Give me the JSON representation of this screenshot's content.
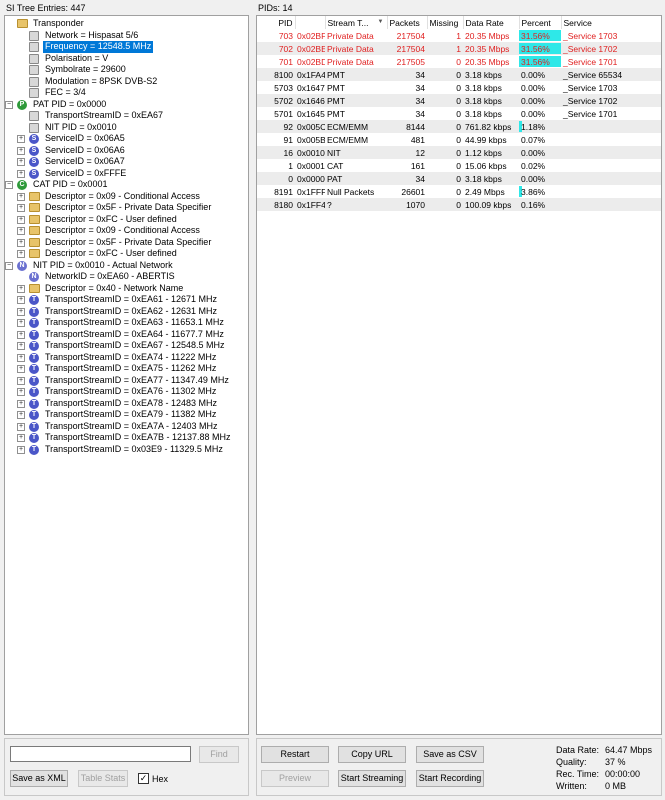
{
  "tree_header": "SI Tree Entries: 447",
  "pids_header": "PIDs: 14",
  "tree": [
    {
      "label": "Transponder",
      "level": 0,
      "icon": "folder",
      "exp": ""
    },
    {
      "label": "Network = Hispasat 5/6",
      "level": 1,
      "icon": "gray",
      "exp": ""
    },
    {
      "label": "Frequency = 12548.5 MHz",
      "level": 1,
      "icon": "gray",
      "exp": "",
      "selected": true
    },
    {
      "label": "Polarisation = V",
      "level": 1,
      "icon": "gray",
      "exp": ""
    },
    {
      "label": "Symbolrate = 29600",
      "level": 1,
      "icon": "gray",
      "exp": ""
    },
    {
      "label": "Modulation = 8PSK DVB-S2",
      "level": 1,
      "icon": "gray",
      "exp": ""
    },
    {
      "label": "FEC = 3/4",
      "level": 1,
      "icon": "gray",
      "exp": ""
    },
    {
      "label": "PAT PID = 0x0000",
      "level": 0,
      "icon": "p",
      "glyph": "P",
      "exp": "-"
    },
    {
      "label": "TransportStreamID = 0xEA67",
      "level": 1,
      "icon": "gray",
      "exp": ""
    },
    {
      "label": "NIT PID = 0x0010",
      "level": 1,
      "icon": "gray",
      "exp": ""
    },
    {
      "label": "ServiceID = 0x06A5",
      "level": 1,
      "icon": "s",
      "glyph": "S",
      "exp": "+"
    },
    {
      "label": "ServiceID = 0x06A6",
      "level": 1,
      "icon": "s",
      "glyph": "S",
      "exp": "+"
    },
    {
      "label": "ServiceID = 0x06A7",
      "level": 1,
      "icon": "s",
      "glyph": "S",
      "exp": "+"
    },
    {
      "label": "ServiceID = 0xFFFE",
      "level": 1,
      "icon": "s",
      "glyph": "S",
      "exp": "+"
    },
    {
      "label": "CAT PID = 0x0001",
      "level": 0,
      "icon": "c",
      "glyph": "C",
      "exp": "-"
    },
    {
      "label": "Descriptor = 0x09 - Conditional Access",
      "level": 1,
      "icon": "folder",
      "exp": "+"
    },
    {
      "label": "Descriptor = 0x5F - Private Data Specifier",
      "level": 1,
      "icon": "folder",
      "exp": "+"
    },
    {
      "label": "Descriptor = 0xFC - User defined",
      "level": 1,
      "icon": "folder",
      "exp": "+"
    },
    {
      "label": "Descriptor = 0x09 - Conditional Access",
      "level": 1,
      "icon": "folder",
      "exp": "+"
    },
    {
      "label": "Descriptor = 0x5F - Private Data Specifier",
      "level": 1,
      "icon": "folder",
      "exp": "+"
    },
    {
      "label": "Descriptor = 0xFC - User defined",
      "level": 1,
      "icon": "folder",
      "exp": "+"
    },
    {
      "label": "NIT PID = 0x0010 - Actual Network",
      "level": 0,
      "icon": "n",
      "glyph": "N",
      "exp": "-"
    },
    {
      "label": "NetworkID = 0xEA60 - ABERTIS",
      "level": 1,
      "icon": "n",
      "glyph": "N",
      "exp": ""
    },
    {
      "label": "Descriptor = 0x40 - Network Name",
      "level": 1,
      "icon": "folder",
      "exp": "+"
    },
    {
      "label": "TransportStreamID = 0xEA61 - 12671 MHz",
      "level": 1,
      "icon": "t",
      "glyph": "T",
      "exp": "+"
    },
    {
      "label": "TransportStreamID = 0xEA62 - 12631 MHz",
      "level": 1,
      "icon": "t",
      "glyph": "T",
      "exp": "+"
    },
    {
      "label": "TransportStreamID = 0xEA63 - 11653.1 MHz",
      "level": 1,
      "icon": "t",
      "glyph": "T",
      "exp": "+"
    },
    {
      "label": "TransportStreamID = 0xEA64 - 11677.7 MHz",
      "level": 1,
      "icon": "t",
      "glyph": "T",
      "exp": "+"
    },
    {
      "label": "TransportStreamID = 0xEA67 - 12548.5 MHz",
      "level": 1,
      "icon": "t",
      "glyph": "T",
      "exp": "+"
    },
    {
      "label": "TransportStreamID = 0xEA74 - 11222 MHz",
      "level": 1,
      "icon": "t",
      "glyph": "T",
      "exp": "+"
    },
    {
      "label": "TransportStreamID = 0xEA75 - 11262 MHz",
      "level": 1,
      "icon": "t",
      "glyph": "T",
      "exp": "+"
    },
    {
      "label": "TransportStreamID = 0xEA77 - 11347.49 MHz",
      "level": 1,
      "icon": "t",
      "glyph": "T",
      "exp": "+"
    },
    {
      "label": "TransportStreamID = 0xEA76 - 11302 MHz",
      "level": 1,
      "icon": "t",
      "glyph": "T",
      "exp": "+"
    },
    {
      "label": "TransportStreamID = 0xEA78 - 12483 MHz",
      "level": 1,
      "icon": "t",
      "glyph": "T",
      "exp": "+"
    },
    {
      "label": "TransportStreamID = 0xEA79 - 11382 MHz",
      "level": 1,
      "icon": "t",
      "glyph": "T",
      "exp": "+"
    },
    {
      "label": "TransportStreamID = 0xEA7A - 12403 MHz",
      "level": 1,
      "icon": "t",
      "glyph": "T",
      "exp": "+"
    },
    {
      "label": "TransportStreamID = 0xEA7B - 12137.88 MHz",
      "level": 1,
      "icon": "t",
      "glyph": "T",
      "exp": "+"
    },
    {
      "label": "TransportStreamID = 0x03E9 - 11329.5 MHz",
      "level": 1,
      "icon": "t",
      "glyph": "T",
      "exp": "+"
    }
  ],
  "columns": [
    "PID",
    "",
    "Stream T...",
    "Packets",
    "Missing",
    "Data Rate",
    "Percent",
    "Service"
  ],
  "rows": [
    {
      "pid": "703",
      "hex": "0x02BF",
      "type": "Private Data",
      "packets": "217504",
      "missing": "1",
      "rate": "20.35 Mbps",
      "percent": "31.56%",
      "pct": 31.56,
      "service": "_Service 1703",
      "red": true
    },
    {
      "pid": "702",
      "hex": "0x02BE",
      "type": "Private Data",
      "packets": "217504",
      "missing": "1",
      "rate": "20.35 Mbps",
      "percent": "31.56%",
      "pct": 31.56,
      "service": "_Service 1702",
      "red": true
    },
    {
      "pid": "701",
      "hex": "0x02BD",
      "type": "Private Data",
      "packets": "217505",
      "missing": "0",
      "rate": "20.35 Mbps",
      "percent": "31.56%",
      "pct": 31.56,
      "service": "_Service 1701",
      "red": true
    },
    {
      "pid": "8100",
      "hex": "0x1FA4",
      "type": "PMT",
      "packets": "34",
      "missing": "0",
      "rate": "3.18 kbps",
      "percent": "0.00%",
      "pct": 0,
      "service": "_Service 65534"
    },
    {
      "pid": "5703",
      "hex": "0x1647",
      "type": "PMT",
      "packets": "34",
      "missing": "0",
      "rate": "3.18 kbps",
      "percent": "0.00%",
      "pct": 0,
      "service": "_Service 1703"
    },
    {
      "pid": "5702",
      "hex": "0x1646",
      "type": "PMT",
      "packets": "34",
      "missing": "0",
      "rate": "3.18 kbps",
      "percent": "0.00%",
      "pct": 0,
      "service": "_Service 1702"
    },
    {
      "pid": "5701",
      "hex": "0x1645",
      "type": "PMT",
      "packets": "34",
      "missing": "0",
      "rate": "3.18 kbps",
      "percent": "0.00%",
      "pct": 0,
      "service": "_Service 1701"
    },
    {
      "pid": "92",
      "hex": "0x005C",
      "type": "ECM/EMM",
      "packets": "8144",
      "missing": "0",
      "rate": "761.82 kbps",
      "percent": "1.18%",
      "pct": 1.18,
      "service": ""
    },
    {
      "pid": "91",
      "hex": "0x005B",
      "type": "ECM/EMM",
      "packets": "481",
      "missing": "0",
      "rate": "44.99 kbps",
      "percent": "0.07%",
      "pct": 0,
      "service": ""
    },
    {
      "pid": "16",
      "hex": "0x0010",
      "type": "NIT",
      "packets": "12",
      "missing": "0",
      "rate": "1.12 kbps",
      "percent": "0.00%",
      "pct": 0,
      "service": ""
    },
    {
      "pid": "1",
      "hex": "0x0001",
      "type": "CAT",
      "packets": "161",
      "missing": "0",
      "rate": "15.06 kbps",
      "percent": "0.02%",
      "pct": 0,
      "service": ""
    },
    {
      "pid": "0",
      "hex": "0x0000",
      "type": "PAT",
      "packets": "34",
      "missing": "0",
      "rate": "3.18 kbps",
      "percent": "0.00%",
      "pct": 0,
      "service": ""
    },
    {
      "pid": "8191",
      "hex": "0x1FFF",
      "type": "Null Packets",
      "packets": "26601",
      "missing": "0",
      "rate": "2.49 Mbps",
      "percent": "3.86%",
      "pct": 3.86,
      "service": ""
    },
    {
      "pid": "8180",
      "hex": "0x1FF4",
      "type": "?",
      "packets": "1070",
      "missing": "0",
      "rate": "100.09 kbps",
      "percent": "0.16%",
      "pct": 0,
      "service": ""
    }
  ],
  "search": {
    "value": "",
    "find_label": "Find"
  },
  "left_buttons": {
    "save_xml": "Save as XML",
    "table_stats": "Table Stats",
    "hex_label": "Hex",
    "hex_checked": "✓"
  },
  "buttons": {
    "restart": "Restart",
    "copy_url": "Copy URL",
    "save_csv": "Save as CSV",
    "preview": "Preview",
    "start_streaming": "Start Streaming",
    "start_recording": "Start Recording"
  },
  "stats": {
    "data_rate_label": "Data Rate:",
    "data_rate": "64.47 Mbps",
    "quality_label": "Quality:",
    "quality": "37 %",
    "rec_time_label": "Rec. Time:",
    "rec_time": "00:00:00",
    "written_label": "Written:",
    "written": "0 MB"
  },
  "colors": {
    "selection": "#0078d7",
    "alert_text": "#e02020",
    "percent_bar": "#2ee8e8"
  }
}
